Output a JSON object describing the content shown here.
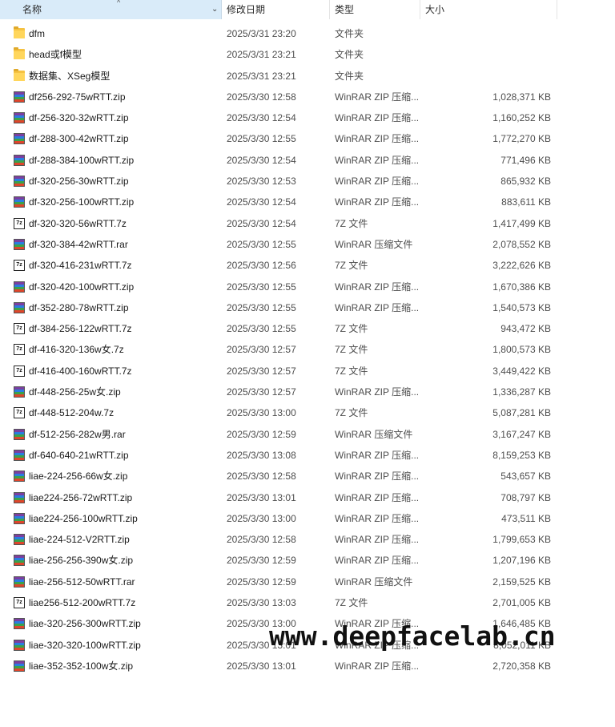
{
  "columns": {
    "name": "名称",
    "date": "修改日期",
    "type": "类型",
    "size": "大小",
    "sort_icon": "chevron-up-icon",
    "dropdown_icon": "chevron-down-icon"
  },
  "files": [
    {
      "name": "dfm",
      "date": "2025/3/31 23:20",
      "type": "文件夹",
      "size": "",
      "icon": "folder"
    },
    {
      "name": "head或f模型",
      "date": "2025/3/31 23:21",
      "type": "文件夹",
      "size": "",
      "icon": "folder"
    },
    {
      "name": "数据集、XSeg模型",
      "date": "2025/3/31 23:21",
      "type": "文件夹",
      "size": "",
      "icon": "folder"
    },
    {
      "name": "df256-292-75wRTT.zip",
      "date": "2025/3/30 12:58",
      "type": "WinRAR ZIP 压缩...",
      "size": "1,028,371 KB",
      "icon": "zip"
    },
    {
      "name": "df-256-320-32wRTT.zip",
      "date": "2025/3/30 12:54",
      "type": "WinRAR ZIP 压缩...",
      "size": "1,160,252 KB",
      "icon": "zip"
    },
    {
      "name": "df-288-300-42wRTT.zip",
      "date": "2025/3/30 12:55",
      "type": "WinRAR ZIP 压缩...",
      "size": "1,772,270 KB",
      "icon": "zip"
    },
    {
      "name": "df-288-384-100wRTT.zip",
      "date": "2025/3/30 12:54",
      "type": "WinRAR ZIP 压缩...",
      "size": "771,496 KB",
      "icon": "zip"
    },
    {
      "name": "df-320-256-30wRTT.zip",
      "date": "2025/3/30 12:53",
      "type": "WinRAR ZIP 压缩...",
      "size": "865,932 KB",
      "icon": "zip"
    },
    {
      "name": "df-320-256-100wRTT.zip",
      "date": "2025/3/30 12:54",
      "type": "WinRAR ZIP 压缩...",
      "size": "883,611 KB",
      "icon": "zip"
    },
    {
      "name": "df-320-320-56wRTT.7z",
      "date": "2025/3/30 12:54",
      "type": "7Z 文件",
      "size": "1,417,499 KB",
      "icon": "7z"
    },
    {
      "name": "df-320-384-42wRTT.rar",
      "date": "2025/3/30 12:55",
      "type": "WinRAR 压缩文件",
      "size": "2,078,552 KB",
      "icon": "rar"
    },
    {
      "name": "df-320-416-231wRTT.7z",
      "date": "2025/3/30 12:56",
      "type": "7Z 文件",
      "size": "3,222,626 KB",
      "icon": "7z"
    },
    {
      "name": "df-320-420-100wRTT.zip",
      "date": "2025/3/30 12:55",
      "type": "WinRAR ZIP 压缩...",
      "size": "1,670,386 KB",
      "icon": "zip"
    },
    {
      "name": "df-352-280-78wRTT.zip",
      "date": "2025/3/30 12:55",
      "type": "WinRAR ZIP 压缩...",
      "size": "1,540,573 KB",
      "icon": "zip"
    },
    {
      "name": "df-384-256-122wRTT.7z",
      "date": "2025/3/30 12:55",
      "type": "7Z 文件",
      "size": "943,472 KB",
      "icon": "7z"
    },
    {
      "name": "df-416-320-136w女.7z",
      "date": "2025/3/30 12:57",
      "type": "7Z 文件",
      "size": "1,800,573 KB",
      "icon": "7z"
    },
    {
      "name": "df-416-400-160wRTT.7z",
      "date": "2025/3/30 12:57",
      "type": "7Z 文件",
      "size": "3,449,422 KB",
      "icon": "7z"
    },
    {
      "name": "df-448-256-25w女.zip",
      "date": "2025/3/30 12:57",
      "type": "WinRAR ZIP 压缩...",
      "size": "1,336,287 KB",
      "icon": "zip"
    },
    {
      "name": "df-448-512-204w.7z",
      "date": "2025/3/30 13:00",
      "type": "7Z 文件",
      "size": "5,087,281 KB",
      "icon": "7z"
    },
    {
      "name": "df-512-256-282w男.rar",
      "date": "2025/3/30 12:59",
      "type": "WinRAR 压缩文件",
      "size": "3,167,247 KB",
      "icon": "rar"
    },
    {
      "name": "df-640-640-21wRTT.zip",
      "date": "2025/3/30 13:08",
      "type": "WinRAR ZIP 压缩...",
      "size": "8,159,253 KB",
      "icon": "zip"
    },
    {
      "name": "liae-224-256-66w女.zip",
      "date": "2025/3/30 12:58",
      "type": "WinRAR ZIP 压缩...",
      "size": "543,657 KB",
      "icon": "zip"
    },
    {
      "name": "liae224-256-72wRTT.zip",
      "date": "2025/3/30 13:01",
      "type": "WinRAR ZIP 压缩...",
      "size": "708,797 KB",
      "icon": "zip"
    },
    {
      "name": "liae224-256-100wRTT.zip",
      "date": "2025/3/30 13:00",
      "type": "WinRAR ZIP 压缩...",
      "size": "473,511 KB",
      "icon": "zip"
    },
    {
      "name": "liae-224-512-V2RTT.zip",
      "date": "2025/3/30 12:58",
      "type": "WinRAR ZIP 压缩...",
      "size": "1,799,653 KB",
      "icon": "zip"
    },
    {
      "name": "liae-256-256-390w女.zip",
      "date": "2025/3/30 12:59",
      "type": "WinRAR ZIP 压缩...",
      "size": "1,207,196 KB",
      "icon": "zip"
    },
    {
      "name": "liae-256-512-50wRTT.rar",
      "date": "2025/3/30 12:59",
      "type": "WinRAR 压缩文件",
      "size": "2,159,525 KB",
      "icon": "rar"
    },
    {
      "name": "liae256-512-200wRTT.7z",
      "date": "2025/3/30 13:03",
      "type": "7Z 文件",
      "size": "2,701,005 KB",
      "icon": "7z"
    },
    {
      "name": "liae-320-256-300wRTT.zip",
      "date": "2025/3/30 13:00",
      "type": "WinRAR ZIP 压缩...",
      "size": "1,646,485 KB",
      "icon": "zip"
    },
    {
      "name": "liae-320-320-100wRTT.zip",
      "date": "2025/3/30 13:01",
      "type": "WinRAR ZIP 压缩...",
      "size": "8,052,011 KB",
      "icon": "zip"
    },
    {
      "name": "liae-352-352-100w女.zip",
      "date": "2025/3/30 13:01",
      "type": "WinRAR ZIP 压缩...",
      "size": "2,720,358 KB",
      "icon": "zip"
    }
  ],
  "watermark": "www.deepfacelab.cn"
}
